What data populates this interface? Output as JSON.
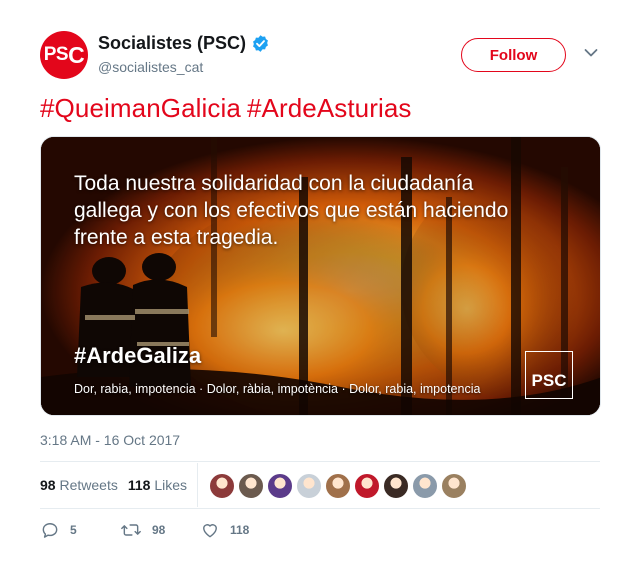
{
  "author": {
    "avatar_text_ps": "PS",
    "avatar_text_c": "C",
    "name": "Socialistes (PSC)",
    "handle": "@socialistes_cat",
    "verified": true
  },
  "follow_label": "Follow",
  "tweet": {
    "hashtags": [
      "#QueimanGalicia",
      "#ArdeAsturias"
    ]
  },
  "media": {
    "headline": "Toda nuestra solidaridad con la ciudadanía gallega y con los efectivos que están haciendo frente a esta tragedia.",
    "hashtag": "#ArdeGaliza",
    "caption": "Dor, rabia, impotencia · Dolor, ràbia, impotència · Dolor, rabia, impotencia",
    "logo": "PSC"
  },
  "timestamp": "3:18 AM - 16 Oct 2017",
  "stats": {
    "retweets_count": "98",
    "retweets_label": "Retweets",
    "likes_count": "118",
    "likes_label": "Likes"
  },
  "likers_colors": [
    "#8c3a3a",
    "#6b5a4e",
    "#5b3b8a",
    "#c8d0d8",
    "#a0704a",
    "#c0182a",
    "#3a2a24",
    "#8a9aaa",
    "#9a8060"
  ],
  "actions": {
    "replies": "5",
    "retweets": "98",
    "likes": "118"
  },
  "colors": {
    "brand": "#e3061b",
    "verified": "#1da1f2",
    "muted": "#657786"
  }
}
